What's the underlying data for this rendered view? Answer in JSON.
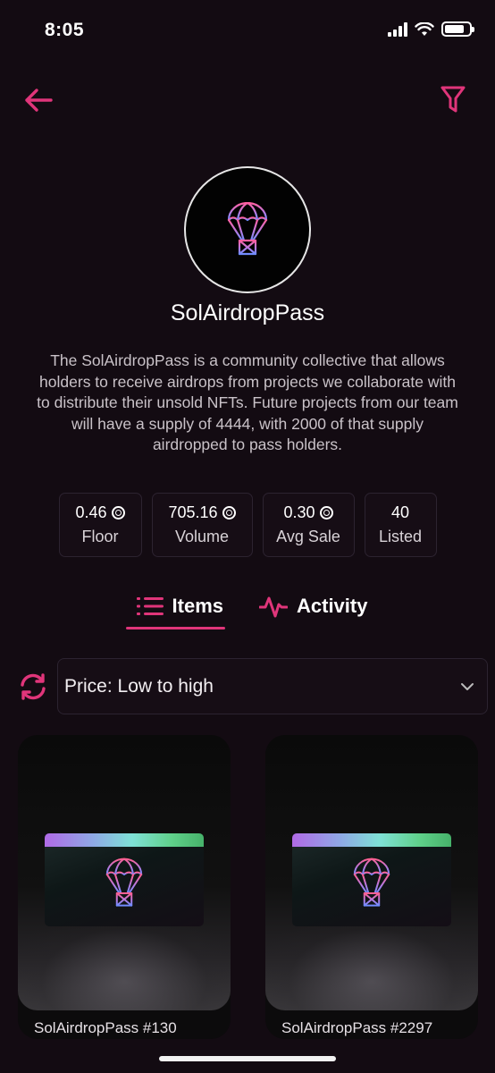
{
  "status_bar": {
    "time": "8:05"
  },
  "header": {
    "back_icon": "arrow-left-icon",
    "filter_icon": "funnel-icon"
  },
  "collection": {
    "avatar_icon": "parachute-icon",
    "name": "SolAirdropPass",
    "description": "The SolAirdropPass is a community collective that allows holders to receive airdrops from projects we collaborate with to distribute their unsold NFTs. Future projects from our team will have a supply of 4444, with 2000 of that supply airdropped to pass holders."
  },
  "stats": [
    {
      "value": "0.46",
      "label": "Floor",
      "currency_icon": true
    },
    {
      "value": "705.16",
      "label": "Volume",
      "currency_icon": true
    },
    {
      "value": "0.30",
      "label": "Avg Sale",
      "currency_icon": true
    },
    {
      "value": "40",
      "label": "Listed",
      "currency_icon": false
    }
  ],
  "tabs": [
    {
      "label": "Items",
      "icon": "list-icon",
      "active": true
    },
    {
      "label": "Activity",
      "icon": "pulse-icon",
      "active": false
    }
  ],
  "sort": {
    "refresh_icon": "refresh-icon",
    "selected": "Price: Low to high",
    "chevron_icon": "chevron-down-icon"
  },
  "items": [
    {
      "title": "SolAirdropPass #130"
    },
    {
      "title": "SolAirdropPass #2297"
    }
  ],
  "colors": {
    "background": "#130b12",
    "accent": "#e0357a",
    "panel": "#160d15",
    "border": "#2c2330"
  }
}
